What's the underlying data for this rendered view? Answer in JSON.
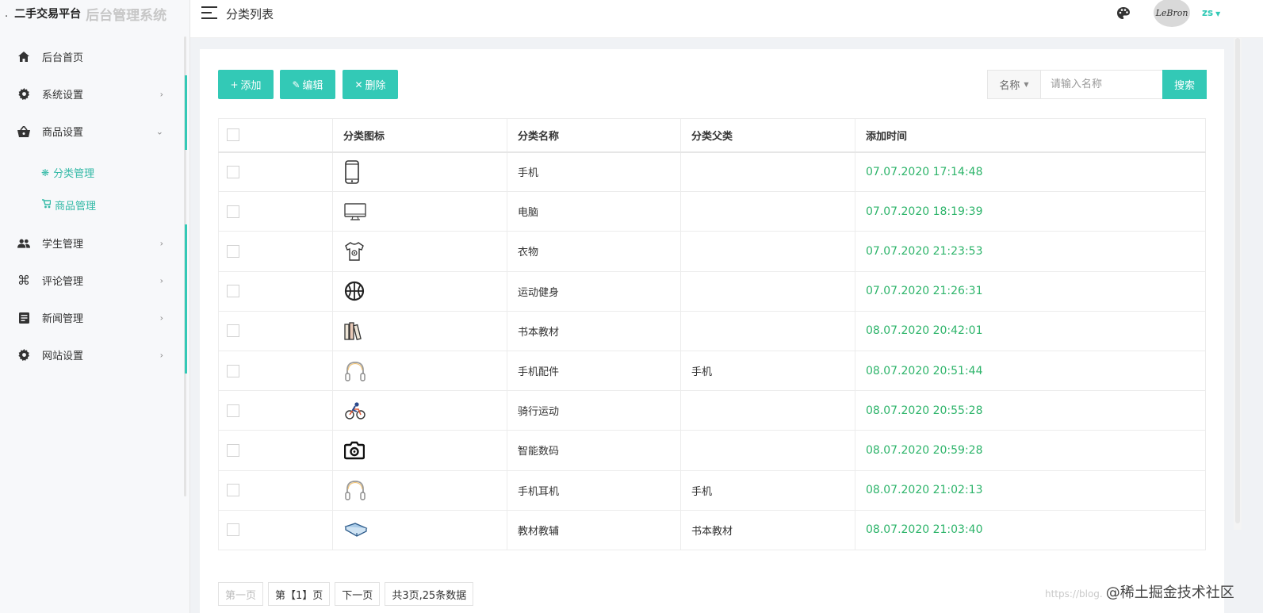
{
  "brand": {
    "prefix": ".",
    "title": "二手交易平台",
    "subtitle": "后台管理系统"
  },
  "header": {
    "page_title": "分类列表",
    "user_name": "zs",
    "avatar_text": "LeBron"
  },
  "sidebar": {
    "items": [
      {
        "label": "后台首页",
        "icon": "home-icon"
      },
      {
        "label": "系统设置",
        "icon": "gear-icon"
      },
      {
        "label": "商品设置",
        "icon": "basket-icon"
      },
      {
        "label": "学生管理",
        "icon": "users-icon"
      },
      {
        "label": "评论管理",
        "icon": "command-icon"
      },
      {
        "label": "新闻管理",
        "icon": "news-icon"
      },
      {
        "label": "网站设置",
        "icon": "gear-icon"
      }
    ],
    "subitems": [
      {
        "label": "分类管理",
        "icon": "asterisk-icon"
      },
      {
        "label": "商品管理",
        "icon": "stroller-icon"
      }
    ]
  },
  "toolbar": {
    "add_label": "添加",
    "edit_label": "编辑",
    "delete_label": "删除"
  },
  "search": {
    "field_label": "名称",
    "placeholder": "请输入名称",
    "button_label": "搜索"
  },
  "table": {
    "headers": [
      "分类图标",
      "分类名称",
      "分类父类",
      "添加时间"
    ],
    "rows": [
      {
        "icon": "phone-icon",
        "name": "手机",
        "parent": "",
        "time": "07.07.2020 17:14:48"
      },
      {
        "icon": "monitor-icon",
        "name": "电脑",
        "parent": "",
        "time": "07.07.2020 18:19:39"
      },
      {
        "icon": "tshirt-icon",
        "name": "衣物",
        "parent": "",
        "time": "07.07.2020 21:23:53"
      },
      {
        "icon": "basketball-icon",
        "name": "运动健身",
        "parent": "",
        "time": "07.07.2020 21:26:31"
      },
      {
        "icon": "books-icon",
        "name": "书本教材",
        "parent": "",
        "time": "08.07.2020 20:42:01"
      },
      {
        "icon": "headphones-icon",
        "name": "手机配件",
        "parent": "手机",
        "time": "08.07.2020 20:51:44"
      },
      {
        "icon": "cyclist-icon",
        "name": "骑行运动",
        "parent": "",
        "time": "08.07.2020 20:55:28"
      },
      {
        "icon": "camera-icon",
        "name": "智能数码",
        "parent": "",
        "time": "08.07.2020 20:59:28"
      },
      {
        "icon": "headphones-icon",
        "name": "手机耳机",
        "parent": "手机",
        "time": "08.07.2020 21:02:13"
      },
      {
        "icon": "open-book-icon",
        "name": "教材教辅",
        "parent": "书本教材",
        "time": "08.07.2020 21:03:40"
      }
    ]
  },
  "pager": {
    "first": "第一页",
    "current": "第【1】页",
    "next": "下一页",
    "summary": "共3页,25条数据"
  },
  "watermark": {
    "small": "https://blog.",
    "big": "@稀土掘金技术社区"
  },
  "colors": {
    "accent": "#33c9b6",
    "time": "#2db46a"
  }
}
